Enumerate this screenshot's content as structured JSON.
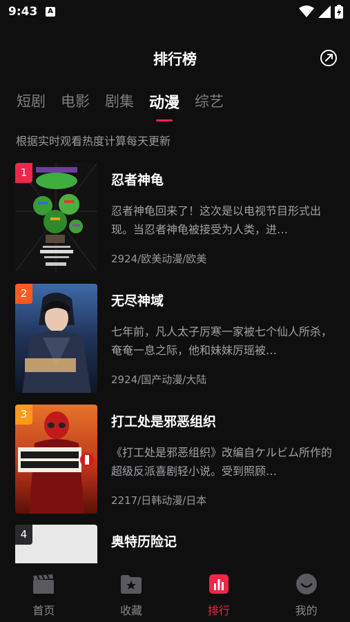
{
  "status_bar": {
    "time": "9:43",
    "badge": "A"
  },
  "header": {
    "title": "排行榜"
  },
  "tabs": [
    {
      "label": "短剧",
      "active": false
    },
    {
      "label": "电影",
      "active": false
    },
    {
      "label": "剧集",
      "active": false
    },
    {
      "label": "动漫",
      "active": true
    },
    {
      "label": "综艺",
      "active": false
    }
  ],
  "subtitle": "根据实时观看热度计算每天更新",
  "items": [
    {
      "rank": "1",
      "rank_color": "#f0264b",
      "title": "忍者神龟",
      "desc": "忍者神龟回来了！这次是以电视节目形式出现。当忍者神龟被接受为人类，进…",
      "meta": "2924/欧美动漫/欧美",
      "poster_text": [
        "TALES OF THE",
        "TEENAGE MUTANT NINJA",
        "TURTLES",
        "STREAMING",
        "AUGUST 9",
        "Paramount+"
      ]
    },
    {
      "rank": "2",
      "rank_color": "#ff5a1f",
      "title": "无尽神域",
      "desc": "七年前，凡人太子厉寒一家被七个仙人所杀，奄奄一息之际，他和妹妹厉瑶被…",
      "meta": "2924/国产动漫/大陆",
      "poster_text": [
        "无尽神域"
      ]
    },
    {
      "rank": "3",
      "rank_color": "#ff9a1a",
      "title": "打工处是邪恶组织",
      "desc": "《打工处是邪恶组织》改编自ケルビム所作的超级反派喜剧轻小说。受到照顾…",
      "meta": "2217/日韩动漫/日本",
      "poster_text": [
        "バイト先は",
        "「悪の組織」!?",
        "1"
      ]
    },
    {
      "rank": "4",
      "rank_color": "#2a2a2c",
      "title": "奥特历险记",
      "desc": "",
      "meta": "",
      "poster_text": []
    }
  ],
  "nav": [
    {
      "label": "首页",
      "icon": "clapperboard-icon",
      "active": false
    },
    {
      "label": "收藏",
      "icon": "star-folder-icon",
      "active": false
    },
    {
      "label": "排行",
      "icon": "chart-icon",
      "active": true
    },
    {
      "label": "我的",
      "icon": "smile-icon",
      "active": false
    }
  ],
  "colors": {
    "accent": "#f0264b",
    "background": "#0f0f10"
  }
}
